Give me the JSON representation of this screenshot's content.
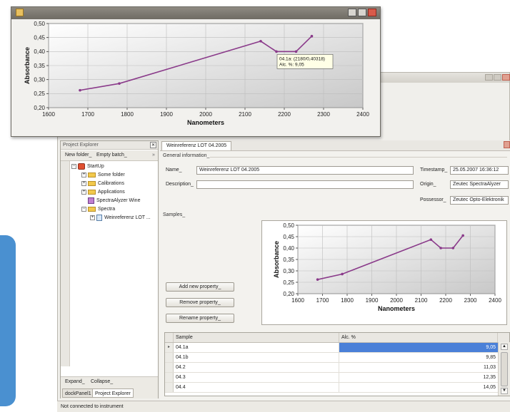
{
  "colors": {
    "series": "#8a3a8a",
    "accent": "#4a90d0",
    "selection": "#4a80d8"
  },
  "chart_data": {
    "type": "line",
    "xlabel": "Nanometers",
    "ylabel": "Absorbance",
    "xlim": [
      1600,
      2400
    ],
    "ylim": [
      0.2,
      0.5
    ],
    "xticks": [
      "1600",
      "1700",
      "1800",
      "1900",
      "2000",
      "2100",
      "2200",
      "2300",
      "2400"
    ],
    "yticks": [
      "0,20",
      "0,25",
      "0,30",
      "0,35",
      "0,40",
      "0,45",
      "0,50"
    ],
    "grid": true,
    "x": [
      1680,
      1780,
      2140,
      2180,
      2230,
      2270
    ],
    "y": [
      0.262,
      0.286,
      0.437,
      0.4,
      0.4,
      0.455
    ],
    "tooltip": [
      "04.1a: (2180/0,40318)",
      "Alc. %: 9,05"
    ]
  },
  "project_explorer": {
    "title": "Project Explorer",
    "pin": "✕",
    "new_folder": "New folder_",
    "empty_batch": "Empty batch_",
    "tree": [
      {
        "label": "StartUp",
        "icon": "root-icon",
        "expander": "−"
      },
      {
        "label": "Some folder",
        "icon": "folder-icon",
        "expander": "+"
      },
      {
        "label": "Calibrations",
        "icon": "folder-icon",
        "expander": "+"
      },
      {
        "label": "Applications",
        "icon": "folder-icon",
        "expander": "+"
      },
      {
        "label": "SpectraAlyzer Wine",
        "icon": "application-icon",
        "expander": ""
      },
      {
        "label": "Spectra",
        "icon": "folder-icon",
        "expander": "−"
      },
      {
        "label": "Weinreferenz LOT ...",
        "icon": "document-icon",
        "expander": "+"
      }
    ],
    "expand": "Expand_",
    "collapse": "Collapse_",
    "tabs": [
      "dockPanel1",
      "Project Explorer"
    ]
  },
  "document": {
    "tab_label": "Weinreferenz LOT 04.2005",
    "general_info": "General information_",
    "name_label": "Name_",
    "name_value": "Weinreferenz LOT 04.2005",
    "description_label": "Description_",
    "description_value": "",
    "timestamp_label": "Timestamp_",
    "timestamp_value": "25.05.2007 16:36:12",
    "origin_label": "Origin_",
    "origin_value": "Zeutec SpectraAlyzer",
    "possessor_label": "Possessor_",
    "possessor_value": "Zeutec Opto-Elektronik",
    "samples_label": "Samples_",
    "add_property": "Add new property_",
    "remove_property": "Remove property_",
    "rename_property": "Rename property_"
  },
  "table": {
    "columns": [
      "Sample",
      "Alc. %"
    ],
    "rows": [
      {
        "sample": "04.1a",
        "alc": "9,05"
      },
      {
        "sample": "04.1b",
        "alc": "9,85"
      },
      {
        "sample": "04.2",
        "alc": "11,03"
      },
      {
        "sample": "04.3",
        "alc": "12,35"
      },
      {
        "sample": "04.4",
        "alc": "14,05"
      }
    ],
    "row_marker": "▸"
  },
  "status": "Not connected to instrument"
}
